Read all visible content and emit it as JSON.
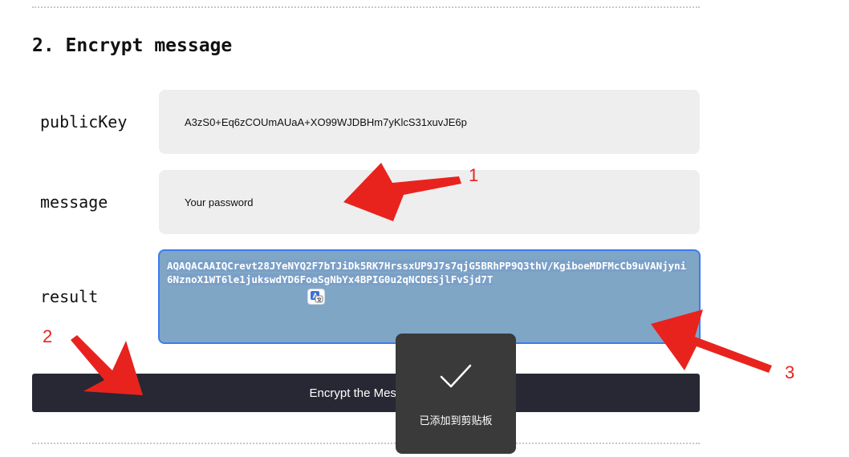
{
  "section": {
    "heading": "2. Encrypt message"
  },
  "fields": {
    "public_key": {
      "label": "publicKey",
      "value": "A3zS0+Eq6zCOUmAUaA+XO99WJDBHm7yKlcS31xuvJE6p"
    },
    "message": {
      "label": "message",
      "value": "Your password"
    },
    "result": {
      "label": "result",
      "value": "AQAQACAAIQCrevt28JYeNYQ2F7bTJiDk5RK7HrssxUP9J7s7qjG5BRhPP9Q3thV/KgiboeMDFMcCb9uVANjyni6NznoX1WT6le1jukswdYD6FoaSgNbYx4BPIG0u2qNCDESjlFvSjd7T"
    }
  },
  "button": {
    "label": "Encrypt the Message"
  },
  "toast": {
    "text": "已添加到剪贴板",
    "icon": "check-icon"
  },
  "annotations": {
    "marker_1": "1",
    "marker_2": "2",
    "marker_3": "3",
    "color": "#e8231e"
  },
  "colors": {
    "button_bg": "#272833",
    "field_bg": "#eeeeee",
    "result_selection_bg": "#80a6c6",
    "result_border": "#3d7bf2",
    "toast_bg": "#3a3a3a"
  }
}
